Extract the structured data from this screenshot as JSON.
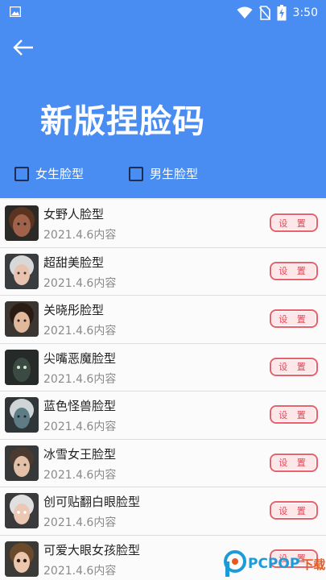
{
  "status_bar": {
    "time": "3:50"
  },
  "header": {
    "title": "新版捏脸码"
  },
  "filters": [
    {
      "label": "女生脸型"
    },
    {
      "label": "男生脸型"
    }
  ],
  "list": {
    "button_label": "设 置",
    "items": [
      {
        "name": "女野人脸型",
        "subtitle": "2021.4.6内容"
      },
      {
        "name": "超甜美脸型",
        "subtitle": "2021.4.6内容"
      },
      {
        "name": "关晓彤脸型",
        "subtitle": "2021.4.6内容"
      },
      {
        "name": "尖嘴恶魔脸型",
        "subtitle": "2021.4.6内容"
      },
      {
        "name": "蓝色怪兽脸型",
        "subtitle": "2021.4.6内容"
      },
      {
        "name": "冰雪女王脸型",
        "subtitle": "2021.4.6内容"
      },
      {
        "name": "创可贴翻白眼脸型",
        "subtitle": "2021.4.6内容"
      },
      {
        "name": "可爱大眼女孩脸型",
        "subtitle": "2021.4.6内容"
      }
    ]
  },
  "watermark": {
    "text": "PCPOP",
    "suffix": "下载"
  },
  "colors": {
    "header": "#4a8df2",
    "button_border": "#e8616b",
    "button_text": "#e0485a"
  }
}
